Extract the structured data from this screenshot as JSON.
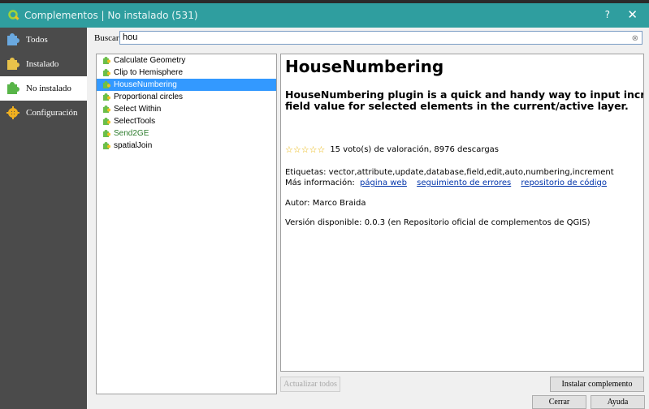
{
  "window": {
    "title": "Complementos | No instalado (531)",
    "help_label": "?",
    "close_label": "✕"
  },
  "sidebar": {
    "items": [
      {
        "label": "Todos",
        "icon": "puzzle-blue-icon"
      },
      {
        "label": "Instalado",
        "icon": "puzzle-yellow-icon"
      },
      {
        "label": "No instalado",
        "icon": "puzzle-green-icon",
        "active": true
      },
      {
        "label": "Configuración",
        "icon": "gear-icon"
      }
    ]
  },
  "search": {
    "label": "Buscar",
    "value": "hou"
  },
  "plugins": [
    {
      "name": "Calculate Geometry"
    },
    {
      "name": "Clip to Hemisphere"
    },
    {
      "name": "HouseNumbering",
      "selected": true
    },
    {
      "name": "Proportional circles"
    },
    {
      "name": "Select Within"
    },
    {
      "name": "SelectTools"
    },
    {
      "name": "Send2GE",
      "green": true
    },
    {
      "name": "spatialJoin"
    }
  ],
  "detail": {
    "title": "HouseNumbering",
    "description_line1": "HouseNumbering plugin is a quick and handy way to input increasing",
    "description_line2": "field value for selected elements in the current/active layer.",
    "stars": "☆☆☆☆☆",
    "rating_text": "15 voto(s) de valoración, 8976 descargas",
    "tags": "Etiquetas: vector,attribute,update,database,field,edit,auto,numbering,increment",
    "more_label": "Más información:",
    "link_web": "página web",
    "link_bugs": "seguimiento de errores",
    "link_repo": "repositorio de código",
    "author": "Autor: Marco Braida",
    "version": "Versión disponible: 0.0.3 (en Repositorio oficial de complementos de QGIS)"
  },
  "buttons": {
    "update_all": "Actualizar todos",
    "install": "Instalar complemento",
    "close": "Cerrar",
    "help": "Ayuda"
  },
  "colors": {
    "titlebar": "#2f9e9f",
    "sidebar": "#4b4b4b",
    "selection": "#3399ff",
    "link": "#0033aa"
  }
}
